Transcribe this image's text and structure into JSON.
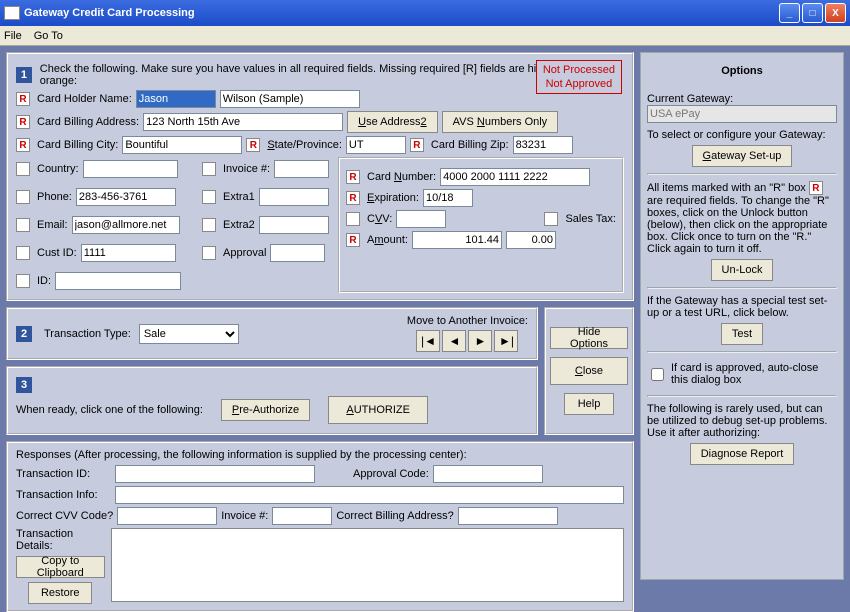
{
  "window": {
    "title": "Gateway Credit Card Processing"
  },
  "menu": {
    "file": "File",
    "goto": "Go To"
  },
  "step1": {
    "num": "1",
    "instruction": "Check the following.  Make sure you have values in all required fields.  Missing required [R] fields are highlighted in orange:",
    "status1": "Not Processed",
    "status2": "Not Approved",
    "labels": {
      "cardholder": "Card Holder Name:",
      "billaddr": "Card Billing Address:",
      "useaddr2": "Use Address2",
      "avs": "AVS Numbers Only",
      "billcity": "Card Billing City:",
      "stateprov": "State/Province:",
      "billzip": "Card Billing Zip:",
      "country": "Country:",
      "phone": "Phone:",
      "email": "Email:",
      "custid": "Cust ID:",
      "id": "ID:",
      "invoice": "Invoice #:",
      "extra1": "Extra1",
      "extra2": "Extra2",
      "approval": "Approval",
      "cardnum": "Card Number:",
      "exp": "Expiration:",
      "cvv": "CVV:",
      "salestax": "Sales Tax:",
      "amount": "Amount:"
    },
    "values": {
      "first": "Jason",
      "last": "Wilson (Sample)",
      "addr": "123 North 15th Ave",
      "city": "Bountiful",
      "state": "UT",
      "zip": "83231",
      "country": "",
      "phone": "283-456-3761",
      "email": "jason@allmore.net",
      "custid": "1111",
      "id": "",
      "invoice": "",
      "extra1": "",
      "extra2": "",
      "approval": "",
      "cardnum": "4000 2000 1111 2222",
      "exp": "10/18",
      "cvv": "",
      "salestax": "0.00",
      "amount": "101.44"
    }
  },
  "step2": {
    "num": "2",
    "typelabel": "Transaction Type:",
    "typevalue": "Sale",
    "movelabel": "Move to Another Invoice:"
  },
  "step3": {
    "num": "3",
    "instruction": "When ready, click one of the following:",
    "preauth": "Pre-Authorize",
    "authorize": "AUTHORIZE"
  },
  "sidebuttons": {
    "hide": "Hide Options",
    "close": "Close",
    "help": "Help"
  },
  "responses": {
    "header": "Responses (After processing, the following information is supplied by the processing center):",
    "tranid": "Transaction ID:",
    "approval": "Approval Code:",
    "traninfo": "Transaction Info:",
    "cvv": "Correct CVV Code?",
    "invoice": "Invoice #:",
    "billing": "Correct Billing Address?",
    "details": "Transaction Details:",
    "copy": "Copy to Clipboard",
    "restore": "Restore"
  },
  "options": {
    "title": "Options",
    "curgw": "Current Gateway:",
    "gwvalue": "USA ePay",
    "sel": "To select or configure your Gateway:",
    "setup": "Gateway Set-up",
    "rtext1": "All items marked with an \"R\" box ",
    "rtext2": " are required fields.  To change the \"R\" boxes, click on the Unlock button (below), then click on the appropriate box. Click once to turn on the \"R.\" Click again to turn it off.",
    "unlock": "Un-Lock",
    "testtext": "If the Gateway has a special test set-up or a test URL, click below.",
    "test": "Test",
    "autoclose": "If card is approved, auto-close this dialog box",
    "debugtext": "The following is rarely used, but can be utilized to debug set-up problems. Use it after authorizing:",
    "diagnose": "Diagnose Report"
  }
}
